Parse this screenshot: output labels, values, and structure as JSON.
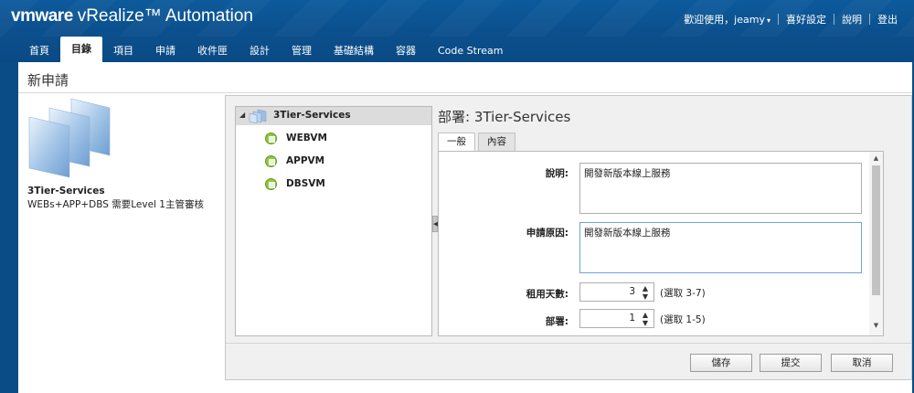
{
  "header": {
    "brand": "vmware",
    "product": "vRealize™ Automation",
    "welcome": "歡迎使用，jeamy",
    "preferences": "喜好設定",
    "help": "說明",
    "logout": "登出"
  },
  "tabs": [
    {
      "label": "首頁"
    },
    {
      "label": "目錄",
      "active": true
    },
    {
      "label": "項目"
    },
    {
      "label": "申請"
    },
    {
      "label": "收件匣"
    },
    {
      "label": "設計"
    },
    {
      "label": "管理"
    },
    {
      "label": "基礎結構"
    },
    {
      "label": "容器"
    },
    {
      "label": "Code Stream"
    }
  ],
  "page": {
    "title": "新申請",
    "catalog_item": {
      "name": "3Tier-Services",
      "description": "WEBs+APP+DBS 需要Level 1主管審核"
    }
  },
  "tree": {
    "root": "3Tier-Services",
    "children": [
      "WEBVM",
      "APPVM",
      "DBSVM"
    ]
  },
  "detail": {
    "title": "部署: 3Tier-Services",
    "tabs": [
      "一般",
      "內容"
    ],
    "fields": {
      "description_label": "說明:",
      "description_value": "開發新版本線上服務",
      "reason_label": "申請原因:",
      "reason_value": "開發新版本線上服務",
      "lease_label": "租用天數:",
      "lease_value": "3",
      "lease_range": "(選取 3-7)",
      "deploy_label": "部署:",
      "deploy_value": "1",
      "deploy_range": "(選取 1-5)"
    }
  },
  "buttons": {
    "save": "儲存",
    "submit": "提交",
    "cancel": "取消"
  },
  "colors": {
    "header_blue": "#0b4f8c",
    "status_green": "#8ec73b"
  }
}
